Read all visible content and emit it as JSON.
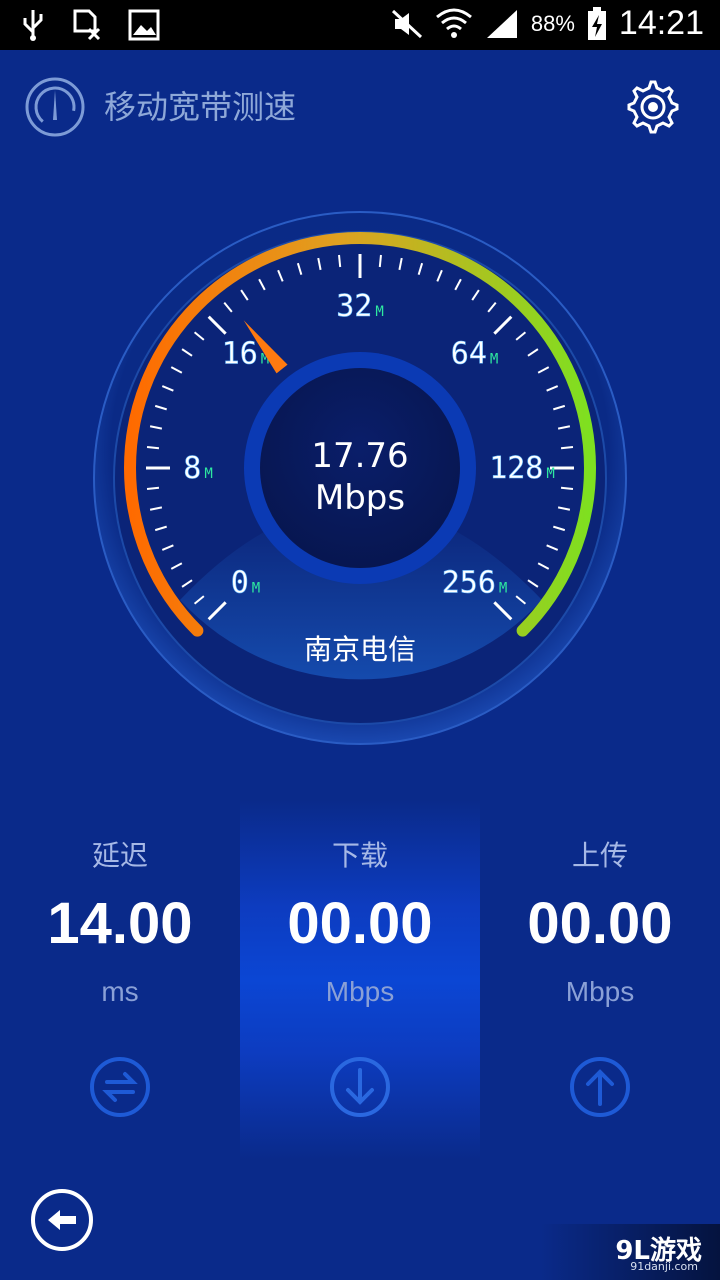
{
  "status_bar": {
    "battery": "88%",
    "time": "14:21",
    "icons": [
      "usb-icon",
      "sim-off-icon",
      "image-icon",
      "mute-icon",
      "wifi-icon",
      "signal-icon",
      "battery-charging-icon"
    ]
  },
  "app": {
    "title": "移动宽带测速",
    "logo_icon": "speedometer-icon",
    "settings_icon": "gear-icon"
  },
  "gauge": {
    "ticks": [
      {
        "num": "0",
        "unit": "M"
      },
      {
        "num": "8",
        "unit": "M"
      },
      {
        "num": "16",
        "unit": "M"
      },
      {
        "num": "32",
        "unit": "M"
      },
      {
        "num": "64",
        "unit": "M"
      },
      {
        "num": "128",
        "unit": "M"
      },
      {
        "num": "256",
        "unit": "M"
      }
    ],
    "needle_value_mbps": 17.76,
    "speed_value": "17.76",
    "speed_unit": "Mbps",
    "isp": "南京电信",
    "colors": {
      "low": "#ff6a00",
      "mid": "#e0b020",
      "high": "#7ee020",
      "accent": "#2ee8a0"
    }
  },
  "stats": [
    {
      "label": "延迟",
      "value": "14.00",
      "unit": "ms",
      "icon": "swap-arrows-icon"
    },
    {
      "label": "下载",
      "value": "00.00",
      "unit": "Mbps",
      "icon": "download-arrow-icon"
    },
    {
      "label": "上传",
      "value": "00.00",
      "unit": "Mbps",
      "icon": "upload-arrow-icon"
    }
  ],
  "nav": {
    "back_icon": "back-arrow-icon"
  },
  "watermark": {
    "text": "9L游戏",
    "sub": "91danji.com"
  }
}
